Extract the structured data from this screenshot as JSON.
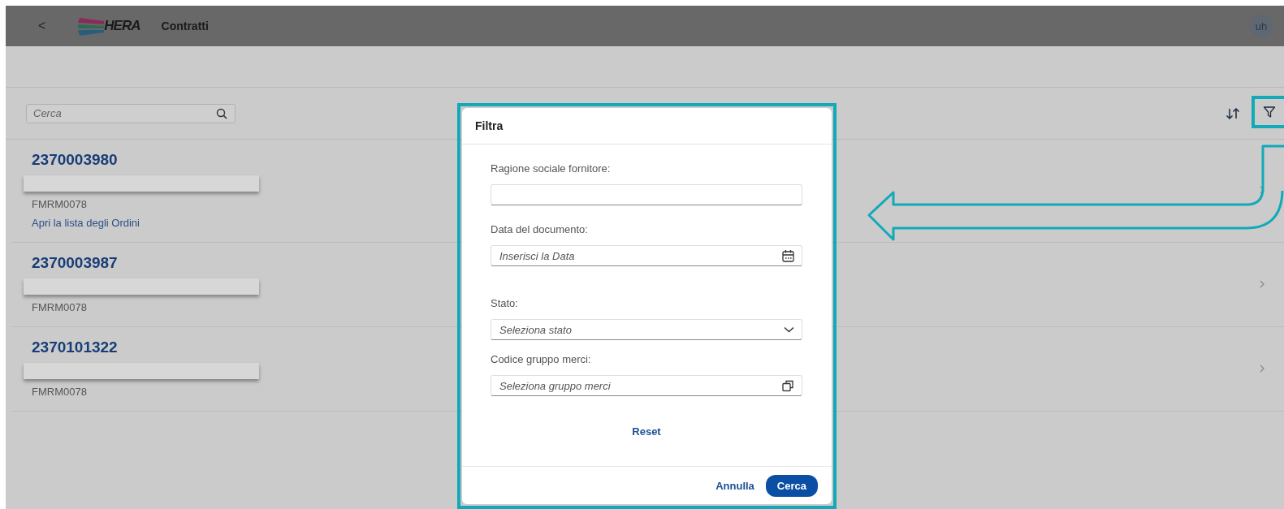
{
  "header": {
    "back": "<",
    "logo": "HERA",
    "title": "Contratti",
    "avatar": "uh"
  },
  "search": {
    "placeholder": "Cerca"
  },
  "rows": [
    {
      "number": "2370003980",
      "redacted": true,
      "code": "FMRM0078",
      "link": "Apri la lista degli Ordini"
    },
    {
      "number": "2370003987",
      "redacted": true,
      "code": "FMRM0078"
    },
    {
      "number": "2370101322",
      "redacted": true,
      "code": "FMRM0078"
    }
  ],
  "dialog": {
    "title": "Filtra",
    "fields": [
      {
        "kind": "text",
        "label": "Ragione sociale fornitore:"
      },
      {
        "kind": "date",
        "label": "Data del documento:",
        "placeholder": "Inserisci la Data"
      },
      {
        "kind": "select",
        "label": "Stato:",
        "placeholder": "Seleziona stato"
      },
      {
        "kind": "valuehelp",
        "label": "Codice gruppo merci:",
        "placeholder": "Seleziona gruppo merci"
      }
    ],
    "reset": "Reset",
    "cancel": "Annulla",
    "confirm": "Cerca"
  }
}
